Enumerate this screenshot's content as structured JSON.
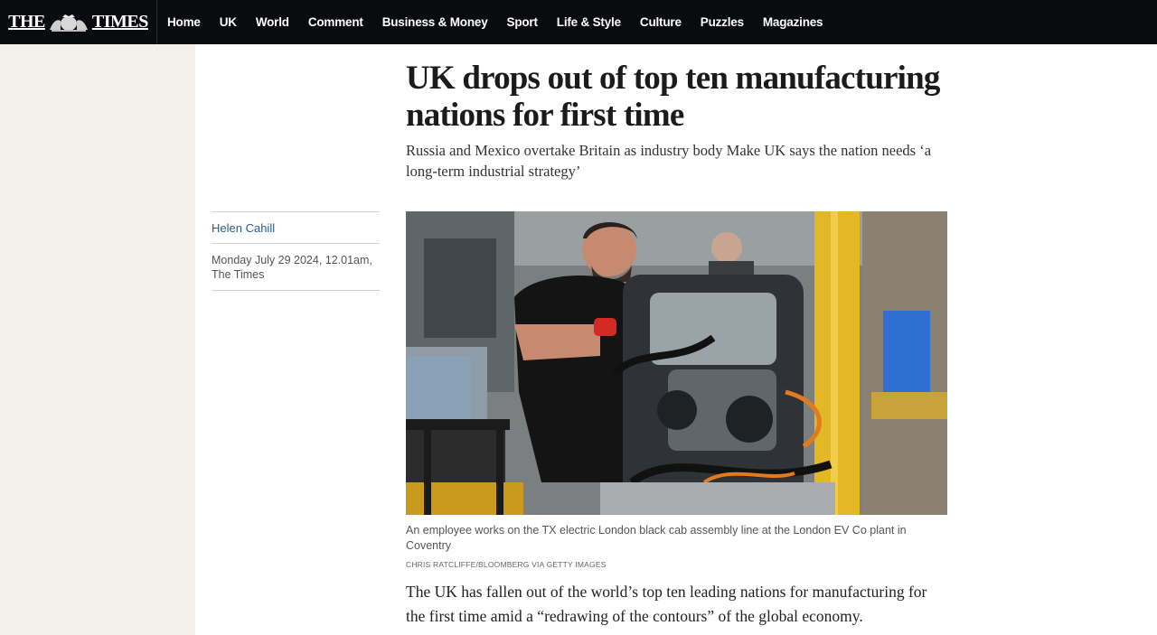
{
  "brand": {
    "left": "THE",
    "right": "TIMES",
    "crest_icon": "royal-crest-icon"
  },
  "nav": {
    "items": [
      "Home",
      "UK",
      "World",
      "Comment",
      "Business & Money",
      "Sport",
      "Life & Style",
      "Culture",
      "Puzzles",
      "Magazines"
    ]
  },
  "article": {
    "headline": "UK drops out of top ten manufacturing nations for first time",
    "standfirst": "Russia and Mexico overtake Britain as industry body Make UK says the nation needs ‘a long-term industrial strategy’",
    "author": "Helen Cahill",
    "dateline": "Monday July 29 2024, 12.01am, The Times",
    "image_caption": "An employee works on the TX electric London black cab assembly line at the London EV Co plant in Coventry",
    "image_credit": "CHRIS RATCLIFFE/BLOOMBERG VIA GETTY IMAGES",
    "body_first_paragraph": "The UK has fallen out of the world’s top ten leading nations for manufacturing for the first time amid a “redrawing of the contours” of the global economy."
  },
  "colors": {
    "nav_bg": "#0a0b0f",
    "side_panel": "#f3f0ec",
    "author_link": "#2a5c8a"
  }
}
